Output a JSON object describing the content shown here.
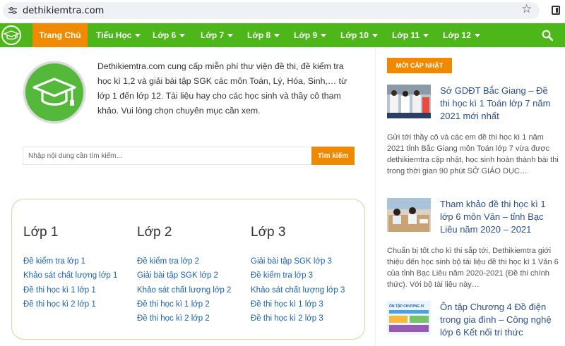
{
  "browser": {
    "url": "dethikiemtra.com"
  },
  "nav": {
    "items": [
      {
        "label": "Trang Chủ",
        "active": true,
        "caret": false
      },
      {
        "label": "Tiểu Học",
        "caret": true
      },
      {
        "label": "Lớp 6",
        "caret": true
      },
      {
        "label": "Lớp 7",
        "caret": true
      },
      {
        "label": "Lớp 8",
        "caret": true
      },
      {
        "label": "Lớp 9",
        "caret": true
      },
      {
        "label": "Lớp 10",
        "caret": true
      },
      {
        "label": "Lớp 11",
        "caret": true
      },
      {
        "label": "Lớp 12",
        "caret": true
      }
    ]
  },
  "intro": {
    "text": "Dethikiemtra.com cung cấp miễn phí thư viện đề thi, đề kiểm tra học kì 1,2 và giải bài tập SGK các môn Toán, Lý, Hóa, Sinh,… từ lớp 1 đến lớp 12. Tài liệu hay cho các học sinh và thầy cô tham khảo. Vui lòng chọn chuyên mục cần xem."
  },
  "search": {
    "placeholder": "Nhập nội dung cần tìm kiếm...",
    "button": "Tìm kiếm"
  },
  "grades": [
    {
      "title": "Lớp 1",
      "links": [
        "Đề kiểm tra lớp 1",
        "Khảo sát chất lượng lớp 1",
        "Đề thi học kì 1 lớp 1",
        "Đề thi học kì 2 lớp 1"
      ]
    },
    {
      "title": "Lớp 2",
      "links": [
        "Đề kiểm tra lớp 2",
        "Giải bài tập SGK lớp 2",
        "Khảo sát chất lượng lớp 2",
        "Đề thi học kì 1 lớp 2",
        "Đề thi học kì 2 lớp 2"
      ]
    },
    {
      "title": "Lớp 3",
      "links": [
        "Giải bài tập SGK lớp 3",
        "Đề kiểm tra lớp 3",
        "Khảo sát chất lượng lớp 3",
        "Đề thi học kì 1 lớp 3",
        "Đề thi học kì 2 lớp 3"
      ]
    }
  ],
  "sidebar": {
    "badge": "MỚI CẬP NHẬT",
    "posts": [
      {
        "title": "Sở GDĐT Bắc Giang – Đề thi học kì 1 Toán lớp 7 năm 2021 mới nhất",
        "excerpt": "Gửi tới thầy cô và các em đề thi học kì 1 năm 2021 tỉnh Bắc Giang môn Toán lớp 7 vừa được dethikiemtra cập nhật, học sinh hoàn thành bài thi trong thời gian 90 phút SỞ GIÁO DỤC…"
      },
      {
        "title": "Tham khảo đề thi học kì 1 lớp 6 môn Văn – tỉnh Bạc Liêu năm 2020 – 2021",
        "excerpt": "Chuẩn bị tốt cho kì thi sắp tới, Dethikiemtra giới thiệu đến học sinh bộ tài liệu đề thi học kì 1 Văn 6 của tỉnh Bạc Liêu năm 2020-2021 (Đề thi chính thức). Với bộ tài liệu này…"
      },
      {
        "title": "Ôn tập Chương 4 Đồ điện trong gia đình – Công nghệ lớp 6 Kết nối tri thức",
        "excerpt": "",
        "thumb_label": "ÔN TẬP CHƯƠNG IV"
      }
    ]
  },
  "colors": {
    "nav": "#4db619",
    "accent": "#ef8a00",
    "link": "#1a62b3",
    "title": "#2b4f8a"
  }
}
